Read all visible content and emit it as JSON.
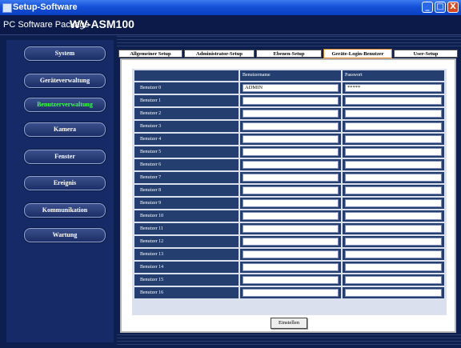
{
  "window": {
    "title": "Setup-Software",
    "package_label": "PC Software Package",
    "model": "WV-ASM100",
    "min_symbol": "_",
    "max_symbol": "□",
    "close_symbol": "X"
  },
  "sidebar": {
    "items": [
      {
        "label": "System",
        "active": false
      },
      {
        "label": "Geräteverwaltung",
        "active": false
      },
      {
        "label": "Benutzerverwaltung",
        "active": true
      },
      {
        "label": "Kamera",
        "active": false
      },
      {
        "label": "Fenster",
        "active": false
      },
      {
        "label": "Ereignis",
        "active": false
      },
      {
        "label": "Kommunikation",
        "active": false
      },
      {
        "label": "Wartung",
        "active": false
      }
    ]
  },
  "tabs": [
    {
      "label": "Allgemeiner Setup"
    },
    {
      "label": "Administrator-Setup"
    },
    {
      "label": "Ebenen-Setup"
    },
    {
      "label": "Geräte-Login-Benutzer",
      "active": true
    },
    {
      "label": "User-Setup"
    }
  ],
  "table": {
    "columns": [
      "Benutzername",
      "Passwort"
    ],
    "rows": [
      {
        "label": "Benutzer 0",
        "username": "ADMIN",
        "password": "*****"
      },
      {
        "label": "Benutzer 1",
        "username": "",
        "password": ""
      },
      {
        "label": "Benutzer 2",
        "username": "",
        "password": ""
      },
      {
        "label": "Benutzer 3",
        "username": "",
        "password": ""
      },
      {
        "label": "Benutzer 4",
        "username": "",
        "password": ""
      },
      {
        "label": "Benutzer 5",
        "username": "",
        "password": ""
      },
      {
        "label": "Benutzer 6",
        "username": "",
        "password": ""
      },
      {
        "label": "Benutzer 7",
        "username": "",
        "password": ""
      },
      {
        "label": "Benutzer 8",
        "username": "",
        "password": ""
      },
      {
        "label": "Benutzer 9",
        "username": "",
        "password": ""
      },
      {
        "label": "Benutzer 10",
        "username": "",
        "password": ""
      },
      {
        "label": "Benutzer 11",
        "username": "",
        "password": ""
      },
      {
        "label": "Benutzer 12",
        "username": "",
        "password": ""
      },
      {
        "label": "Benutzer 13",
        "username": "",
        "password": ""
      },
      {
        "label": "Benutzer 14",
        "username": "",
        "password": ""
      },
      {
        "label": "Benutzer 15",
        "username": "",
        "password": ""
      },
      {
        "label": "Benutzer 16",
        "username": "",
        "password": ""
      }
    ]
  },
  "actions": {
    "apply_label": "Einstellen"
  },
  "colors": {
    "active_nav_text": "#39ff4a",
    "header_bg": "#243f6f",
    "title_bar": "#1450d8"
  }
}
